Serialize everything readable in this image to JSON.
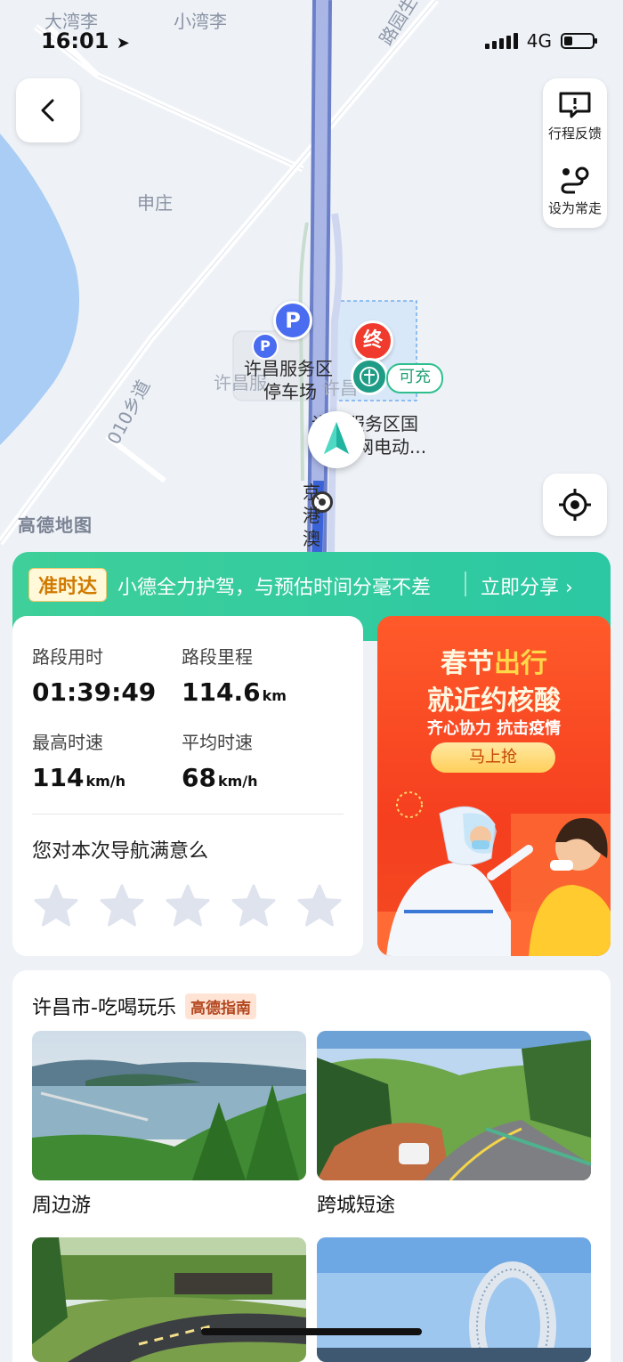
{
  "status_bar": {
    "time": "16:01",
    "network": "4G",
    "battery_level": 0.25
  },
  "map": {
    "labels": {
      "dawanli": "大湾李",
      "xiaowanli": "小湾李",
      "shenzhuang": "申庄",
      "road_east": "路园生东",
      "road_010": "010乡道",
      "parking_label_1": "许昌服务区",
      "parking_label_2": "停车场",
      "grey_left": "许昌服",
      "grey_right": "许昌",
      "ev_label_1": "许昌服务区国",
      "ev_label_2": "网电动...",
      "expressway": "京港澳",
      "end_marker": "终",
      "charge_tag": "可充",
      "logo": "高德地图"
    }
  },
  "side_panel": {
    "feedback_label": "行程反馈",
    "set_frequent_label": "设为常走"
  },
  "banner": {
    "tag": "准时达",
    "text": "小德全力护驾，与预估时间分毫不差",
    "share": "立即分享 ›"
  },
  "stats": {
    "duration_label": "路段用时",
    "duration_value": "01:39:49",
    "distance_label": "路段里程",
    "distance_value": "114.6",
    "distance_unit": "km",
    "max_speed_label": "最高时速",
    "max_speed_value": "114",
    "max_speed_unit": "km/h",
    "avg_speed_label": "平均时速",
    "avg_speed_value": "68",
    "avg_speed_unit": "km/h",
    "question": "您对本次导航满意么",
    "rating": 0
  },
  "ad": {
    "line1_a": "春节",
    "line1_b": "出行",
    "line2": "就近约核酸",
    "line3": "齐心协力 抗击疫情",
    "button": "马上抢"
  },
  "guide": {
    "title": "许昌市-吃喝玩乐",
    "badge": "高德指南",
    "items": [
      {
        "label": "周边游"
      },
      {
        "label": "跨城短途"
      }
    ]
  },
  "colors": {
    "banner_green": "#3ecf9a",
    "ad_red": "#f53f1f",
    "parking_blue": "#4a6cf0",
    "end_red": "#f03a2e"
  }
}
